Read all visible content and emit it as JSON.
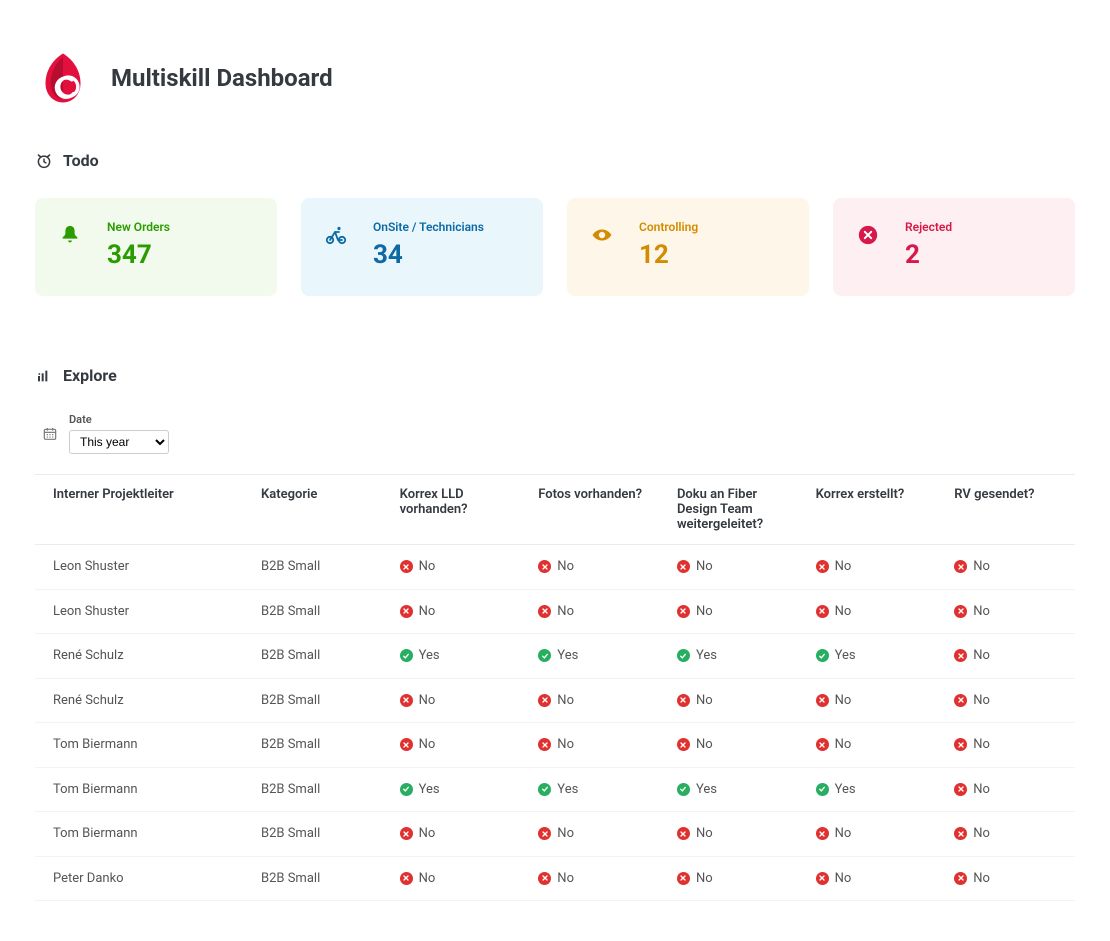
{
  "header": {
    "title": "Multiskill Dashboard"
  },
  "sections": {
    "todo": "Todo",
    "explore": "Explore"
  },
  "cards": [
    {
      "key": "new_orders",
      "label": "New Orders",
      "value": "347",
      "tone": "green"
    },
    {
      "key": "onsite",
      "label": "OnSite / Technicians",
      "value": "34",
      "tone": "blue"
    },
    {
      "key": "controlling",
      "label": "Controlling",
      "value": "12",
      "tone": "orange"
    },
    {
      "key": "rejected",
      "label": "Rejected",
      "value": "2",
      "tone": "red"
    }
  ],
  "filter": {
    "date_label": "Date",
    "date_selected": "This year",
    "date_options": [
      "This year"
    ]
  },
  "table": {
    "columns": [
      "Interner Projektleiter",
      "Kategorie",
      "Korrex LLD vorhanden?",
      "Fotos vorhanden?",
      "Doku an Fiber Design Team weitergeleitet?",
      "Korrex erstellt?",
      "RV gesendet?"
    ],
    "yes_label": "Yes",
    "no_label": "No",
    "rows": [
      {
        "pl": "Leon Shuster",
        "kat": "B2B Small",
        "f": [
          false,
          false,
          false,
          false,
          false
        ]
      },
      {
        "pl": "Leon Shuster",
        "kat": "B2B Small",
        "f": [
          false,
          false,
          false,
          false,
          false
        ]
      },
      {
        "pl": "René Schulz",
        "kat": "B2B Small",
        "f": [
          true,
          true,
          true,
          true,
          false
        ]
      },
      {
        "pl": "René Schulz",
        "kat": "B2B Small",
        "f": [
          false,
          false,
          false,
          false,
          false
        ]
      },
      {
        "pl": "Tom Biermann",
        "kat": "B2B Small",
        "f": [
          false,
          false,
          false,
          false,
          false
        ]
      },
      {
        "pl": "Tom Biermann",
        "kat": "B2B Small",
        "f": [
          true,
          true,
          true,
          true,
          false
        ]
      },
      {
        "pl": "Tom Biermann",
        "kat": "B2B Small",
        "f": [
          false,
          false,
          false,
          false,
          false
        ]
      },
      {
        "pl": "Peter Danko",
        "kat": "B2B Small",
        "f": [
          false,
          false,
          false,
          false,
          false
        ]
      }
    ]
  }
}
